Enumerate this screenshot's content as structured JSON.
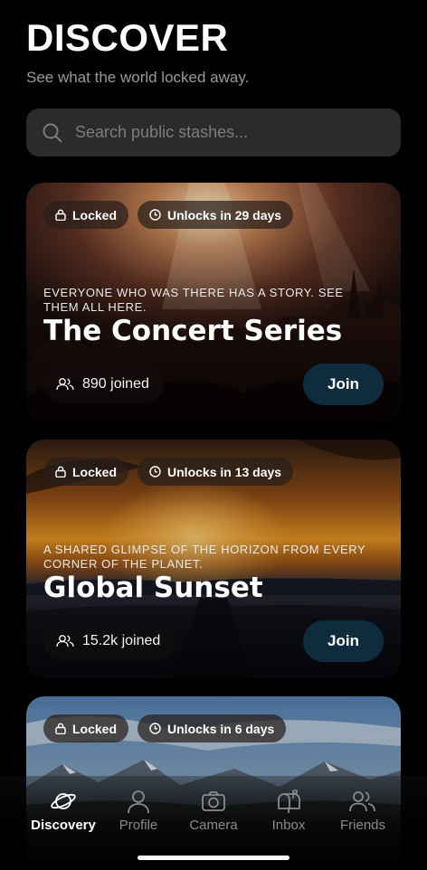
{
  "header": {
    "title": "DISCOVER",
    "subtitle": "See what the world locked away."
  },
  "search": {
    "placeholder": "Search public stashes..."
  },
  "cards": [
    {
      "locked_label": "Locked",
      "unlock_label": "Unlocks in 29 days",
      "tagline": "EVERYONE WHO WAS THERE HAS A STORY. SEE THEM ALL HERE.",
      "title": "The Concert Series",
      "joined": "890 joined",
      "join_label": "Join"
    },
    {
      "locked_label": "Locked",
      "unlock_label": "Unlocks in 13 days",
      "tagline": "A SHARED GLIMPSE OF THE HORIZON FROM EVERY CORNER OF THE PLANET.",
      "title": "Global Sunset",
      "joined": "15.2k joined",
      "join_label": "Join"
    },
    {
      "locked_label": "Locked",
      "unlock_label": "Unlocks in 6 days"
    }
  ],
  "tabbar": {
    "items": [
      {
        "label": "Discovery",
        "icon": "planet-icon",
        "active": true
      },
      {
        "label": "Profile",
        "icon": "person-icon",
        "active": false
      },
      {
        "label": "Camera",
        "icon": "camera-icon",
        "active": false
      },
      {
        "label": "Inbox",
        "icon": "mailbox-icon",
        "active": false
      },
      {
        "label": "Friends",
        "icon": "friends-icon",
        "active": false
      }
    ]
  },
  "colors": {
    "background": "#000000",
    "search_bg": "#2b2b2b",
    "join_button": "#0f2b3e",
    "muted_text": "#9a9a9a"
  }
}
